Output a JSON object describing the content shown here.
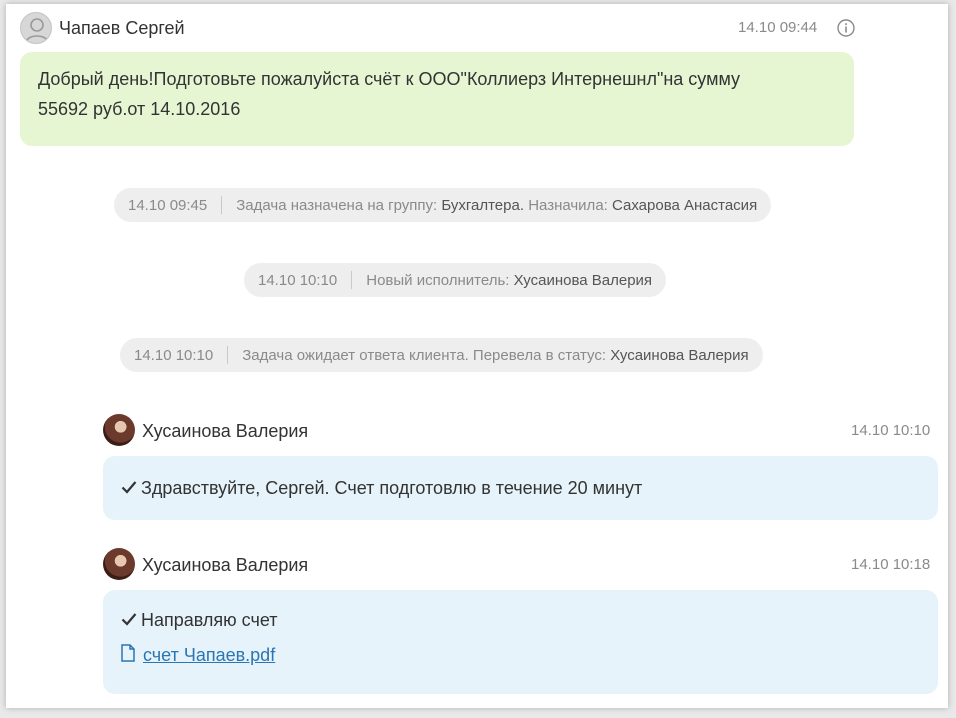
{
  "messages": [
    {
      "author": "Чапаев Сергей",
      "time": "14.10 09:44",
      "text_line1": "Добрый день!Подготовьте пожалуйста счёт к ООО\"Коллиерз Интернешнл\"на сумму",
      "text_line2": "55692 руб.от 14.10.2016",
      "info_icon": "info-icon"
    },
    {
      "author": "Хусаинова Валерия",
      "time": "14.10 10:10",
      "text": "Здравствуйте, Сергей. Счет подготовлю в течение 20 минут"
    },
    {
      "author": "Хусаинова Валерия",
      "time": "14.10 10:18",
      "text": "Направляю счет",
      "attachment": "счет Чапаев.pdf"
    }
  ],
  "events": [
    {
      "time": "14.10 09:45",
      "prefix": "Задача назначена на группу:",
      "value1": "Бухгалтера.",
      "middle": "Назначила:",
      "value2": "Сахарова Анастасия"
    },
    {
      "time": "14.10 10:10",
      "prefix": "Новый исполнитель:",
      "value1": "Хусаинова Валерия"
    },
    {
      "time": "14.10 10:10",
      "prefix": "Задача ожидает ответа клиента. Перевела в статус:",
      "value1": "Хусаинова Валерия"
    }
  ],
  "colors": {
    "client_bubble": "#e6f6d3",
    "agent_bubble": "#e6f3fa",
    "event_pill": "#eeeeee",
    "link": "#2a75b3"
  }
}
